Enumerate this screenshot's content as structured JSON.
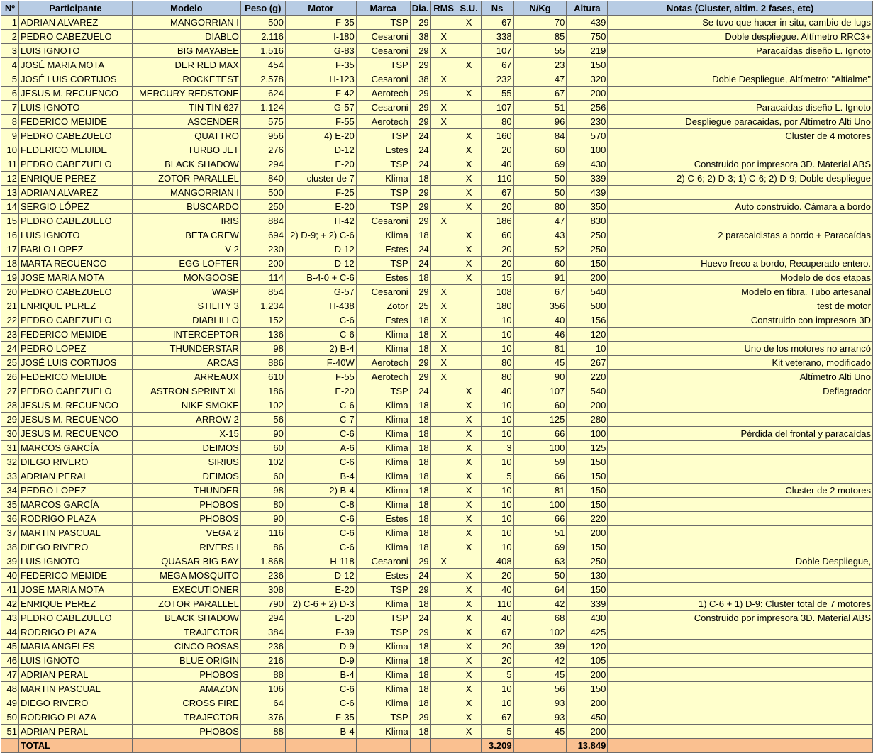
{
  "headers": [
    "Nº",
    "Participante",
    "Modelo",
    "Peso (g)",
    "Motor",
    "Marca",
    "Dia.",
    "RMS",
    "S.U.",
    "Ns",
    "N/Kg",
    "Altura",
    "Notas (Cluster, altim. 2 fases, etc)"
  ],
  "rows": [
    [
      "1",
      "ADRIAN ALVAREZ",
      "MANGORRIAN I",
      "500",
      "F-35",
      "TSP",
      "29",
      "",
      "X",
      "67",
      "70",
      "439",
      "Se tuvo que hacer in situ, cambio de lugs"
    ],
    [
      "2",
      "PEDRO CABEZUELO",
      "DIABLO",
      "2.116",
      "I-180",
      "Cesaroni",
      "38",
      "X",
      "",
      "338",
      "85",
      "750",
      "Doble  despliegue. Altímetro RRC3+"
    ],
    [
      "3",
      "LUIS IGNOTO",
      "BIG MAYABEE",
      "1.516",
      "G-83",
      "Cesaroni",
      "29",
      "X",
      "",
      "107",
      "55",
      "219",
      "Paracaídas diseño L. Ignoto"
    ],
    [
      "4",
      "JOSÉ MARIA MOTA",
      "DER RED MAX",
      "454",
      "F-35",
      "TSP",
      "29",
      "",
      "X",
      "67",
      "23",
      "150",
      ""
    ],
    [
      "5",
      "JOSÉ LUIS CORTIJOS",
      "ROCKETEST",
      "2.578",
      "H-123",
      "Cesaroni",
      "38",
      "X",
      "",
      "232",
      "47",
      "320",
      "Doble Despliegue, Altímetro: \"Altialme\""
    ],
    [
      "6",
      "JESUS M. RECUENCO",
      "MERCURY REDSTONE",
      "624",
      "F-42",
      "Aerotech",
      "29",
      "",
      "X",
      "55",
      "67",
      "200",
      ""
    ],
    [
      "7",
      "LUIS IGNOTO",
      "TIN TIN 627",
      "1.124",
      "G-57",
      "Cesaroni",
      "29",
      "X",
      "",
      "107",
      "51",
      "256",
      "Paracaídas diseño L. Ignoto"
    ],
    [
      "8",
      "FEDERICO MEIJIDE",
      "ASCENDER",
      "575",
      "F-55",
      "Aerotech",
      "29",
      "X",
      "",
      "80",
      "96",
      "230",
      "Despliegue paracaidas, por Altímetro Alti Uno"
    ],
    [
      "9",
      "PEDRO CABEZUELO",
      "QUATTRO",
      "956",
      "4) E-20",
      "TSP",
      "24",
      "",
      "X",
      "160",
      "84",
      "570",
      "Cluster de 4 motores"
    ],
    [
      "10",
      "FEDERICO MEIJIDE",
      "TURBO JET",
      "276",
      "D-12",
      "Estes",
      "24",
      "",
      "X",
      "20",
      "60",
      "100",
      ""
    ],
    [
      "11",
      "PEDRO CABEZUELO",
      "BLACK SHADOW",
      "294",
      "E-20",
      "TSP",
      "24",
      "",
      "X",
      "40",
      "69",
      "430",
      "Construido por impresora 3D. Material ABS"
    ],
    [
      "12",
      "ENRIQUE PEREZ",
      "ZOTOR PARALLEL",
      "840",
      "cluster de 7",
      "Klima",
      "18",
      "",
      "X",
      "110",
      "50",
      "339",
      "2) C-6; 2) D-3; 1) C-6; 2) D-9;   Doble despliegue"
    ],
    [
      "13",
      "ADRIAN ALVAREZ",
      "MANGORRIAN I",
      "500",
      "F-25",
      "TSP",
      "29",
      "",
      "X",
      "67",
      "50",
      "439",
      ""
    ],
    [
      "14",
      "SERGIO LÓPEZ",
      "BUSCARDO",
      "250",
      "E-20",
      "TSP",
      "29",
      "",
      "X",
      "20",
      "80",
      "350",
      "Auto construido. Cámara a bordo"
    ],
    [
      "15",
      "PEDRO CABEZUELO",
      "IRIS",
      "884",
      "H-42",
      "Cesaroni",
      "29",
      "X",
      "",
      "186",
      "47",
      "830",
      ""
    ],
    [
      "16",
      "LUIS IGNOTO",
      "BETA CREW",
      "694",
      "2) D-9; + 2) C-6",
      "Klima",
      "18",
      "",
      "X",
      "60",
      "43",
      "250",
      "2 paracaidistas a bordo + Paracaídas"
    ],
    [
      "17",
      "PABLO LOPEZ",
      "V-2",
      "230",
      "D-12",
      "Estes",
      "24",
      "",
      "X",
      "20",
      "52",
      "250",
      ""
    ],
    [
      "18",
      "MARTA RECUENCO",
      "EGG-LOFTER",
      "200",
      "D-12",
      "TSP",
      "24",
      "",
      "X",
      "20",
      "60",
      "150",
      "Huevo freco a bordo, Recuperado entero."
    ],
    [
      "19",
      "JOSE MARIA MOTA",
      "MONGOOSE",
      "114",
      "B-4-0 + C-6",
      "Estes",
      "18",
      "",
      "X",
      "15",
      "91",
      "200",
      "Modelo de dos etapas"
    ],
    [
      "20",
      "PEDRO CABEZUELO",
      "WASP",
      "854",
      "G-57",
      "Cesaroni",
      "29",
      "X",
      "",
      "108",
      "67",
      "540",
      "Modelo en fibra. Tubo artesanal"
    ],
    [
      "21",
      "ENRIQUE PEREZ",
      "STILITY 3",
      "1.234",
      "H-438",
      "Zotor",
      "25",
      "X",
      "",
      "180",
      "356",
      "500",
      "test de motor"
    ],
    [
      "22",
      "PEDRO CABEZUELO",
      "DIABLILLO",
      "152",
      "C-6",
      "Estes",
      "18",
      "X",
      "",
      "10",
      "40",
      "156",
      "Construido con impresora 3D"
    ],
    [
      "23",
      "FEDERICO MEIJIDE",
      "INTERCEPTOR",
      "136",
      "C-6",
      "Klima",
      "18",
      "X",
      "",
      "10",
      "46",
      "120",
      ""
    ],
    [
      "24",
      "PEDRO LOPEZ",
      "THUNDERSTAR",
      "98",
      "2) B-4",
      "Klima",
      "18",
      "X",
      "",
      "10",
      "81",
      "10",
      "Uno de los motores no arrancó"
    ],
    [
      "25",
      "JOSÉ LUIS CORTIJOS",
      "ARCAS",
      "886",
      "F-40W",
      "Aerotech",
      "29",
      "X",
      "",
      "80",
      "45",
      "267",
      "Kit veterano, modificado"
    ],
    [
      "26",
      "FEDERICO MEIJIDE",
      "ARREAUX",
      "610",
      "F-55",
      "Aerotech",
      "29",
      "X",
      "",
      "80",
      "90",
      "220",
      "Altímetro Alti Uno"
    ],
    [
      "27",
      "PEDRO CABEZUELO",
      "ASTRON SPRINT XL",
      "186",
      "E-20",
      "TSP",
      "24",
      "",
      "X",
      "40",
      "107",
      "540",
      "Deflagrador"
    ],
    [
      "28",
      "JESUS M. RECUENCO",
      "NIKE SMOKE",
      "102",
      "C-6",
      "Klima",
      "18",
      "",
      "X",
      "10",
      "60",
      "200",
      ""
    ],
    [
      "29",
      "JESUS M. RECUENCO",
      "ARROW 2",
      "56",
      "C-7",
      "Klima",
      "18",
      "",
      "X",
      "10",
      "125",
      "280",
      ""
    ],
    [
      "30",
      "JESUS M. RECUENCO",
      "X-15",
      "90",
      "C-6",
      "Klima",
      "18",
      "",
      "X",
      "10",
      "66",
      "100",
      "Pérdida del  frontal y paracaídas"
    ],
    [
      "31",
      "MARCOS GARCÍA",
      "DEIMOS",
      "60",
      "A-6",
      "Klima",
      "18",
      "",
      "X",
      "3",
      "100",
      "125",
      ""
    ],
    [
      "32",
      "DIEGO RIVERO",
      "SIRIUS",
      "102",
      "C-6",
      "Klima",
      "18",
      "",
      "X",
      "10",
      "59",
      "150",
      ""
    ],
    [
      "33",
      "ADRIAN PERAL",
      "DEIMOS",
      "60",
      "B-4",
      "Klima",
      "18",
      "",
      "X",
      "5",
      "66",
      "150",
      ""
    ],
    [
      "34",
      "PEDRO LOPEZ",
      "THUNDER",
      "98",
      "2) B-4",
      "Klima",
      "18",
      "",
      "X",
      "10",
      "81",
      "150",
      "Cluster de 2 motores"
    ],
    [
      "35",
      "MARCOS GARCÍA",
      "PHOBOS",
      "80",
      "C-8",
      "Klima",
      "18",
      "",
      "X",
      "10",
      "100",
      "150",
      ""
    ],
    [
      "36",
      "RODRIGO PLAZA",
      "PHOBOS",
      "90",
      "C-6",
      "Estes",
      "18",
      "",
      "X",
      "10",
      "66",
      "220",
      ""
    ],
    [
      "37",
      "MARTIN PASCUAL",
      "VEGA 2",
      "116",
      "C-6",
      "Klima",
      "18",
      "",
      "X",
      "10",
      "51",
      "200",
      ""
    ],
    [
      "38",
      "DIEGO RIVERO",
      "RIVERS I",
      "86",
      "C-6",
      "Klima",
      "18",
      "",
      "X",
      "10",
      "69",
      "150",
      ""
    ],
    [
      "39",
      "LUIS IGNOTO",
      "QUASAR BIG BAY",
      "1.868",
      "H-118",
      "Cesaroni",
      "29",
      "X",
      "",
      "408",
      "63",
      "250",
      "Doble Despliegue,"
    ],
    [
      "40",
      "FEDERICO MEIJIDE",
      "MEGA MOSQUITO",
      "236",
      "D-12",
      "Estes",
      "24",
      "",
      "X",
      "20",
      "50",
      "130",
      ""
    ],
    [
      "41",
      "JOSE MARIA MOTA",
      "EXECUTIONER",
      "308",
      "E-20",
      "TSP",
      "29",
      "",
      "X",
      "40",
      "64",
      "150",
      ""
    ],
    [
      "42",
      "ENRIQUE PEREZ",
      "ZOTOR PARALLEL",
      "790",
      "2) C-6 + 2) D-3",
      "Klima",
      "18",
      "",
      "X",
      "110",
      "42",
      "339",
      "1) C-6 + 1) D-9: Cluster total de 7 motores"
    ],
    [
      "43",
      "PEDRO CABEZUELO",
      "BLACK SHADOW",
      "294",
      "E-20",
      "TSP",
      "24",
      "",
      "X",
      "40",
      "68",
      "430",
      "Construido por impresora 3D. Material ABS"
    ],
    [
      "44",
      "RODRIGO PLAZA",
      "TRAJECTOR",
      "384",
      "F-39",
      "TSP",
      "29",
      "",
      "X",
      "67",
      "102",
      "425",
      ""
    ],
    [
      "45",
      "MARIA ANGELES",
      "CINCO ROSAS",
      "236",
      "D-9",
      "Klima",
      "18",
      "",
      "X",
      "20",
      "39",
      "120",
      ""
    ],
    [
      "46",
      "LUIS IGNOTO",
      "BLUE ORIGIN",
      "216",
      "D-9",
      "Klima",
      "18",
      "",
      "X",
      "20",
      "42",
      "105",
      ""
    ],
    [
      "47",
      "ADRIAN PERAL",
      "PHOBOS",
      "88",
      "B-4",
      "Klima",
      "18",
      "",
      "X",
      "5",
      "45",
      "200",
      ""
    ],
    [
      "48",
      "MARTIN PASCUAL",
      "AMAZON",
      "106",
      "C-6",
      "Klima",
      "18",
      "",
      "X",
      "10",
      "56",
      "150",
      ""
    ],
    [
      "49",
      "DIEGO RIVERO",
      "CROSS FIRE",
      "64",
      "C-6",
      "Klima",
      "18",
      "",
      "X",
      "10",
      "93",
      "200",
      ""
    ],
    [
      "50",
      "RODRIGO PLAZA",
      "TRAJECTOR",
      "376",
      "F-35",
      "TSP",
      "29",
      "",
      "X",
      "67",
      "93",
      "450",
      ""
    ],
    [
      "51",
      "ADRIAN PERAL",
      "PHOBOS",
      "88",
      "B-4",
      "Klima",
      "18",
      "",
      "X",
      "5",
      "45",
      "200",
      ""
    ]
  ],
  "total": {
    "label": "TOTAL",
    "ns": "3.209",
    "altura": "13.849"
  }
}
